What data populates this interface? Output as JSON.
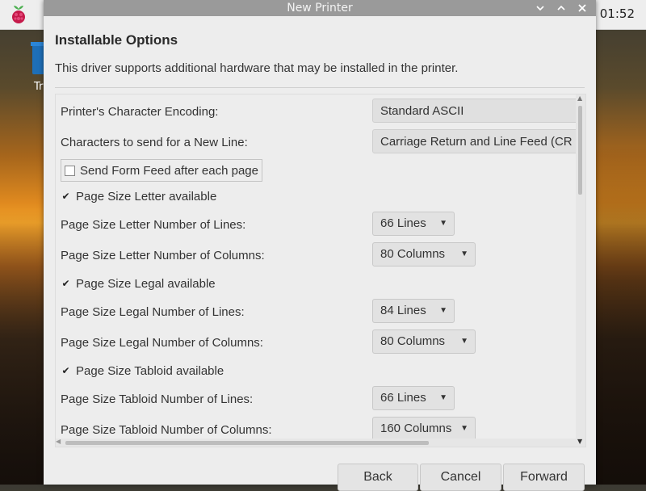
{
  "taskbar": {
    "clock": "01:52",
    "menu_icon": "raspberry-pi-icon"
  },
  "desktop": {
    "icon_label": "Tr",
    "icon_name": "trash-icon"
  },
  "window": {
    "title": "New Printer",
    "buttons": [
      "minimize-icon",
      "maximize-icon",
      "close-icon"
    ]
  },
  "page": {
    "heading": "Installable Options",
    "subtitle": "This driver supports additional hardware that may be installed in the printer."
  },
  "options": {
    "encoding_label": "Printer's Character Encoding:",
    "encoding_value": "Standard ASCII",
    "newline_label": "Characters to send for a New Line:",
    "newline_value": "Carriage Return and Line Feed (CR +",
    "formfeed_label": "Send Form Feed after each page",
    "formfeed_checked": false,
    "letter_avail_label": "Page Size Letter available",
    "letter_lines_label": "Page Size Letter Number of Lines:",
    "letter_lines_value": "66 Lines",
    "letter_cols_label": "Page Size Letter Number of Columns:",
    "letter_cols_value": "80 Columns",
    "legal_avail_label": "Page Size Legal available",
    "legal_lines_label": "Page Size Legal Number of Lines:",
    "legal_lines_value": "84 Lines",
    "legal_cols_label": "Page Size Legal Number of Columns:",
    "legal_cols_value": "80 Columns",
    "tabloid_avail_label": "Page Size Tabloid available",
    "tabloid_lines_label": "Page Size Tabloid Number of Lines:",
    "tabloid_lines_value": "66 Lines",
    "tabloid_cols_label": "Page Size Tabloid Number of Columns:",
    "tabloid_cols_value": "160 Columns"
  },
  "footer": {
    "back": "Back",
    "cancel": "Cancel",
    "forward": "Forward"
  },
  "colors": {
    "titlebar": "#9a9a9a",
    "dialog_bg": "#ededed",
    "raspberry": "#c51a4a"
  }
}
